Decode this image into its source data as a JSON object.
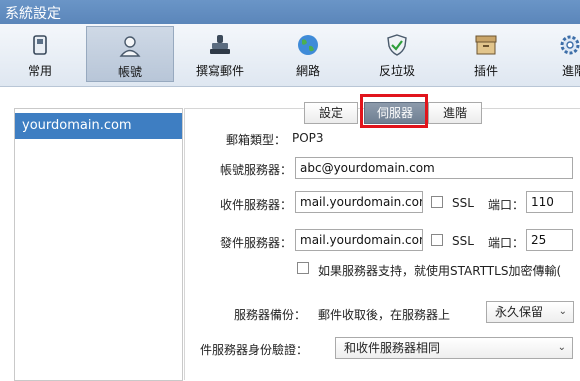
{
  "window": {
    "title": "系統設定"
  },
  "toolbar": {
    "items": [
      {
        "label": "常用",
        "icon": "phone-icon"
      },
      {
        "label": "帳號",
        "icon": "user-icon"
      },
      {
        "label": "撰寫郵件",
        "icon": "stamp-icon"
      },
      {
        "label": "網路",
        "icon": "globe-icon"
      },
      {
        "label": "反垃圾",
        "icon": "shield-icon"
      },
      {
        "label": "插件",
        "icon": "box-icon"
      },
      {
        "label": "進階",
        "icon": "gear-icon"
      }
    ],
    "active": "帳號"
  },
  "sidebar": {
    "account": "yourdomain.com"
  },
  "tabs": [
    {
      "label": "設定"
    },
    {
      "label": "伺服器"
    },
    {
      "label": "進階"
    }
  ],
  "active_tab": "伺服器",
  "form": {
    "mailbox_type_label": "郵箱類型：",
    "mailbox_type_value": "POP3",
    "account_server_label": "帳號服務器：",
    "account_server_value": "abc@yourdomain.com",
    "incoming_label": "收件服務器：",
    "incoming_value": "mail.yourdomain.com",
    "incoming_ssl": "SSL",
    "incoming_port_label": "端口：",
    "incoming_port": "110",
    "outgoing_label": "發件服務器：",
    "outgoing_value": "mail.yourdomain.com",
    "outgoing_ssl": "SSL",
    "outgoing_port_label": "端口：",
    "outgoing_port": "25",
    "starttls_label": "如果服務器支持，就使用STARTTLS加密傳輸(",
    "backup_label": "服務器備份：",
    "backup_desc": "郵件收取後，在服務器上",
    "backup_value": "永久保留",
    "auth_label": "件服務器身份驗證：",
    "auth_value": "和收件服務器相同"
  },
  "colors": {
    "accent": "#3e7ec2",
    "highlight": "#e1141c"
  }
}
